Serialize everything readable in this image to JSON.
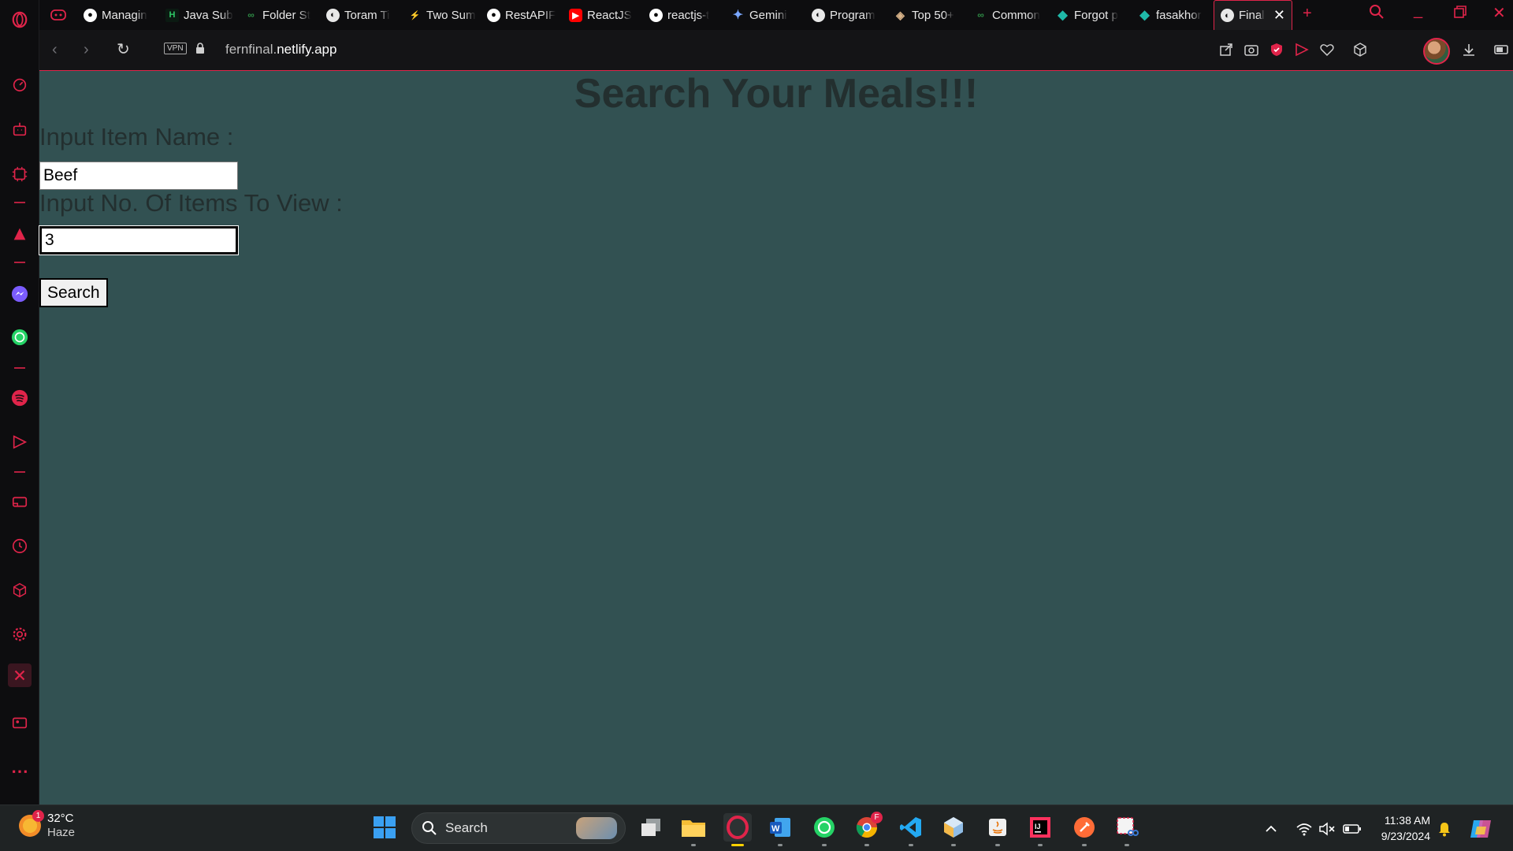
{
  "browser": {
    "tabs": [
      {
        "label": "Managin",
        "icon": "github-icon"
      },
      {
        "label": "Java Sub",
        "icon": "hackerrank-icon"
      },
      {
        "label": "Folder St",
        "icon": "geeksforgeeks-icon"
      },
      {
        "label": "Toram Ti",
        "icon": "globe-icon"
      },
      {
        "label": "Two Sum",
        "icon": "leetcode-icon"
      },
      {
        "label": "RestAPIF",
        "icon": "github-icon"
      },
      {
        "label": "ReactJS",
        "icon": "youtube-icon"
      },
      {
        "label": "reactjs-t",
        "icon": "github-icon"
      },
      {
        "label": "Gemini",
        "icon": "gemini-icon"
      },
      {
        "label": "Program",
        "icon": "globe-icon"
      },
      {
        "label": "Top 50+",
        "icon": "box-icon"
      },
      {
        "label": "Common",
        "icon": "geeksforgeeks-icon"
      },
      {
        "label": "Forgot p",
        "icon": "diamond-icon"
      },
      {
        "label": "fasakhor",
        "icon": "diamond-icon"
      }
    ],
    "active_tab": {
      "label": "Final",
      "icon": "globe-icon"
    },
    "vpn_label": "VPN",
    "url_host": "fernfinal.",
    "url_domain": "netlify.app"
  },
  "page": {
    "title": "Search Your Meals!!!",
    "item_name_label": "Input Item Name :",
    "item_name_value": "Beef",
    "count_label": "Input No. Of Items To View :",
    "count_value": "3",
    "search_button": "Search"
  },
  "taskbar": {
    "weather_temp": "32°C",
    "weather_cond": "Haze",
    "weather_badge": "1",
    "search_label": "Search",
    "time": "11:38 AM",
    "date": "9/23/2024",
    "chrome_badge": "F"
  },
  "colors": {
    "accent": "#e0244a",
    "page_bg": "#325152",
    "page_text": "#232f2f"
  }
}
